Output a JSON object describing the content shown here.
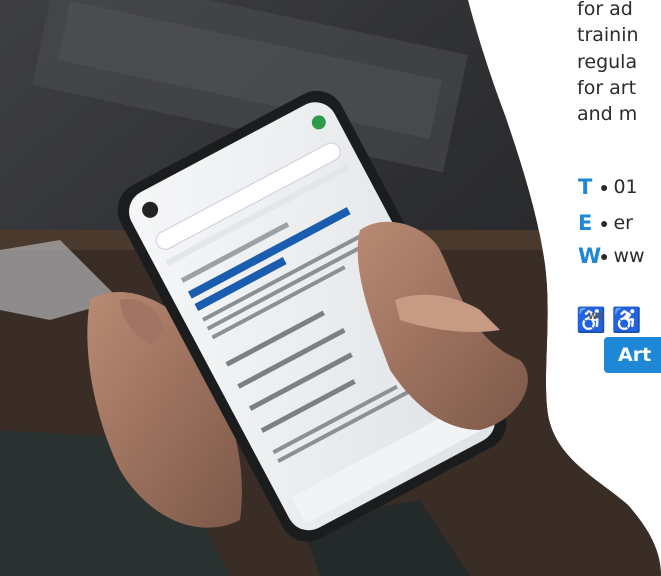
{
  "description_lines": [
    "for ad",
    "trainin",
    "regula",
    "for art",
    "and m"
  ],
  "contact": {
    "phone": {
      "letter": "T",
      "value": "01"
    },
    "email": {
      "letter": "E",
      "value": "er"
    },
    "web": {
      "letter": "W",
      "value": "ww"
    }
  },
  "accessibility": {
    "wc_label": "WC"
  },
  "tag_label": "Art",
  "colors": {
    "accent": "#1e88d6",
    "text": "#2b2b2b"
  }
}
